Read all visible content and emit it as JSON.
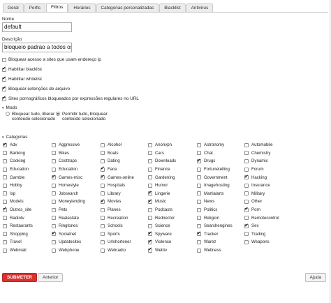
{
  "tabs": [
    {
      "label": "Geral",
      "active": false
    },
    {
      "label": "Perfis",
      "active": false
    },
    {
      "label": "Filtros",
      "active": true
    },
    {
      "label": "Horários",
      "active": false
    },
    {
      "label": "Categorias personalizadas",
      "active": false
    },
    {
      "label": "Blacklist",
      "active": false
    },
    {
      "label": "Antivirus",
      "active": false
    }
  ],
  "form": {
    "name_label": "Nome",
    "name_value": "default",
    "description_label": "Descrição",
    "description_value": "bloqueio padrao a todos os"
  },
  "options": [
    {
      "label": "Bloquear acesso a sites que usam endereço ip",
      "checked": false
    },
    {
      "label": "Habilitar blacklist",
      "checked": true
    },
    {
      "label": "Habilitar whitelist",
      "checked": true
    },
    {
      "label": "Bloquear extenções de arquivo",
      "checked": true
    },
    {
      "label": "Sites pornográficos bloqueados por expressões regulares no URL",
      "checked": true
    }
  ],
  "mode": {
    "title": "Modo",
    "options": [
      {
        "label": "Bloquear tudo, liberar conteúdo selecionado",
        "checked": false
      },
      {
        "label": "Permitir tudo, bloquear conteúdo selecionado",
        "checked": true
      }
    ]
  },
  "categories": {
    "title": "Categorias",
    "items": [
      {
        "label": "Adv",
        "checked": true
      },
      {
        "label": "Aggressive",
        "checked": false
      },
      {
        "label": "Alcohol",
        "checked": false
      },
      {
        "label": "Anonvpn",
        "checked": false
      },
      {
        "label": "Astronomy",
        "checked": false
      },
      {
        "label": "Automobile",
        "checked": false
      },
      {
        "label": "Banking",
        "checked": false
      },
      {
        "label": "Bikes",
        "checked": false
      },
      {
        "label": "Boats",
        "checked": false
      },
      {
        "label": "Cars",
        "checked": false
      },
      {
        "label": "Chat",
        "checked": false
      },
      {
        "label": "Chemistry",
        "checked": false
      },
      {
        "label": "Cooking",
        "checked": false
      },
      {
        "label": "Costtraps",
        "checked": false
      },
      {
        "label": "Dating",
        "checked": false
      },
      {
        "label": "Downloads",
        "checked": false
      },
      {
        "label": "Drugs",
        "checked": true
      },
      {
        "label": "Dynamic",
        "checked": false
      },
      {
        "label": "Education",
        "checked": false
      },
      {
        "label": "Education",
        "checked": false
      },
      {
        "label": "Face",
        "checked": true
      },
      {
        "label": "Finance",
        "checked": false
      },
      {
        "label": "Fortunetelling",
        "checked": false
      },
      {
        "label": "Forum",
        "checked": false
      },
      {
        "label": "Gamble",
        "checked": false
      },
      {
        "label": "Games-misc",
        "checked": true
      },
      {
        "label": "Games-online",
        "checked": true
      },
      {
        "label": "Gardening",
        "checked": false
      },
      {
        "label": "Government",
        "checked": false
      },
      {
        "label": "Hacking",
        "checked": true
      },
      {
        "label": "Hobby",
        "checked": false
      },
      {
        "label": "Homestyle",
        "checked": false
      },
      {
        "label": "Hospitals",
        "checked": false
      },
      {
        "label": "Humor",
        "checked": false
      },
      {
        "label": "Imagehosting",
        "checked": false
      },
      {
        "label": "Insurance",
        "checked": false
      },
      {
        "label": "Isp",
        "checked": false
      },
      {
        "label": "Jobsearch",
        "checked": false
      },
      {
        "label": "Library",
        "checked": false
      },
      {
        "label": "Lingerie",
        "checked": true
      },
      {
        "label": "Martialarts",
        "checked": false
      },
      {
        "label": "Military",
        "checked": false
      },
      {
        "label": "Models",
        "checked": false
      },
      {
        "label": "Moneylending",
        "checked": false
      },
      {
        "label": "Movies",
        "checked": true
      },
      {
        "label": "Music",
        "checked": true
      },
      {
        "label": "News",
        "checked": false
      },
      {
        "label": "Other",
        "checked": false
      },
      {
        "label": "Outros_site",
        "checked": true
      },
      {
        "label": "Pets",
        "checked": false
      },
      {
        "label": "Planes",
        "checked": false
      },
      {
        "label": "Podcasts",
        "checked": false
      },
      {
        "label": "Politics",
        "checked": false
      },
      {
        "label": "Porn",
        "checked": true
      },
      {
        "label": "Radiotv",
        "checked": false
      },
      {
        "label": "Realestate",
        "checked": false
      },
      {
        "label": "Recreation",
        "checked": false
      },
      {
        "label": "Redirector",
        "checked": false
      },
      {
        "label": "Religion",
        "checked": false
      },
      {
        "label": "Remotecontrol",
        "checked": false
      },
      {
        "label": "Restaurants",
        "checked": false
      },
      {
        "label": "Ringtones",
        "checked": false
      },
      {
        "label": "Schools",
        "checked": false
      },
      {
        "label": "Science",
        "checked": false
      },
      {
        "label": "Searchengines",
        "checked": false
      },
      {
        "label": "Sex",
        "checked": true
      },
      {
        "label": "Shopping",
        "checked": false
      },
      {
        "label": "Socialnet",
        "checked": true
      },
      {
        "label": "Sports",
        "checked": false
      },
      {
        "label": "Spyware",
        "checked": true
      },
      {
        "label": "Tracker",
        "checked": true
      },
      {
        "label": "Trading",
        "checked": false
      },
      {
        "label": "Travel",
        "checked": false
      },
      {
        "label": "Updatesites",
        "checked": false
      },
      {
        "label": "Urlshortener",
        "checked": false
      },
      {
        "label": "Violence",
        "checked": true
      },
      {
        "label": "Warez",
        "checked": false
      },
      {
        "label": "Weapons",
        "checked": false
      },
      {
        "label": "Webmail",
        "checked": false
      },
      {
        "label": "Webphone",
        "checked": false
      },
      {
        "label": "Webradio",
        "checked": false
      },
      {
        "label": "Webtv",
        "checked": true
      },
      {
        "label": "Wellness",
        "checked": false
      }
    ]
  },
  "buttons": {
    "submit": "SUBMETER",
    "back": "Anterior",
    "help": "Ajuda"
  },
  "colors": {
    "submit_bg": "#d9322f",
    "tab_bg": "#ececec",
    "active_tab_bg": "#ffffff"
  }
}
